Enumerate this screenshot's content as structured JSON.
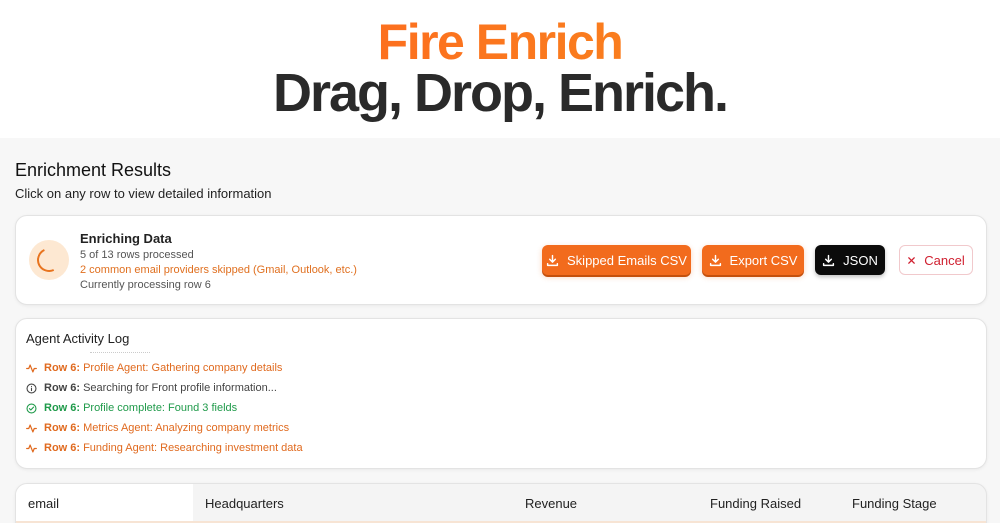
{
  "hero": {
    "brand": "Fire Enrich",
    "tagline": "Drag, Drop, Enrich."
  },
  "results": {
    "title": "Enrichment Results",
    "subtitle": "Click on any row to view detailed information"
  },
  "status": {
    "title": "Enriching Data",
    "rows_processed": "5 of 13 rows processed",
    "skipped_note": "2 common email providers skipped (Gmail, Outlook, etc.)",
    "current": "Currently processing row 6",
    "progress_rows_done": 5,
    "progress_rows_total": 13
  },
  "buttons": {
    "skipped_csv": "Skipped Emails CSV",
    "export_csv": "Export CSV",
    "json": "JSON",
    "cancel": "Cancel"
  },
  "log": {
    "title": "Agent Activity Log",
    "entries": [
      {
        "row": "Row 6:",
        "text": "Profile Agent: Gathering company details",
        "type": "activity",
        "icon": "activity-icon",
        "color": "#e06a1f"
      },
      {
        "row": "Row 6:",
        "text": "Searching for Front profile information...",
        "type": "info",
        "icon": "info-icon",
        "color": "#444444"
      },
      {
        "row": "Row 6:",
        "text": "Profile complete: Found 3 fields",
        "type": "success",
        "icon": "check-circle-icon",
        "color": "#1f9a4a"
      },
      {
        "row": "Row 6:",
        "text": "Metrics Agent: Analyzing company metrics",
        "type": "activity",
        "icon": "activity-icon",
        "color": "#e06a1f"
      },
      {
        "row": "Row 6:",
        "text": "Funding Agent: Researching investment data",
        "type": "activity",
        "icon": "activity-icon",
        "color": "#e06a1f"
      }
    ]
  },
  "table": {
    "columns": [
      "email",
      "Headquarters",
      "Revenue",
      "Funding Raised",
      "Funding Stage"
    ]
  },
  "colors": {
    "brand_orange": "#f26b1d",
    "brand_gradient_end": "#f7931e",
    "success_green": "#1f9a4a",
    "cancel_red": "#d02030"
  }
}
